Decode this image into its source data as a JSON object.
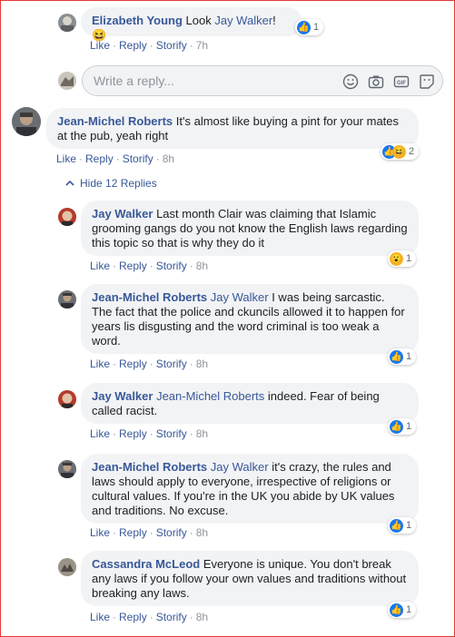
{
  "comments": [
    {
      "author": "Elizabeth Young",
      "mention": "",
      "text": " Look ",
      "mention_after": "Jay Walker",
      "text_after": "! 😆",
      "actions": [
        "Like",
        "Reply",
        "Storify"
      ],
      "time": "7h",
      "reaction_count": "1"
    },
    {
      "author": "Jean-Michel Roberts",
      "mention": "",
      "text": " It's almost like buying a pint for your mates at the pub, yeah right",
      "actions": [
        "Like",
        "Reply",
        "Storify"
      ],
      "time": "8h",
      "reaction_count": "2"
    },
    {
      "author": "Jay Walker",
      "mention": "",
      "text": " Last month Clair was claiming that Islamic grooming gangs do you not know the English laws regarding this topic so that is why they do it",
      "actions": [
        "Like",
        "Reply",
        "Storify"
      ],
      "time": "8h",
      "reaction_count": "1"
    },
    {
      "author": "Jean-Michel Roberts",
      "mention": "Jay Walker",
      "text": " I was being sarcastic. The fact that the police and ckuncils allowed it to happen for years lis disgusting and the word criminal is too weak a word.",
      "actions": [
        "Like",
        "Reply",
        "Storify"
      ],
      "time": "8h",
      "reaction_count": "1"
    },
    {
      "author": "Jay Walker",
      "mention": "Jean-Michel Roberts",
      "text": " indeed. Fear of being called racist.",
      "actions": [
        "Like",
        "Reply",
        "Storify"
      ],
      "time": "8h",
      "reaction_count": "1"
    },
    {
      "author": "Jean-Michel Roberts",
      "mention": "Jay Walker",
      "text": " it's crazy, the rules and laws should apply to everyone, irrespective of religions or cultural values. If you're in the UK you abide by UK values and traditions. No excuse.",
      "actions": [
        "Like",
        "Reply",
        "Storify"
      ],
      "time": "8h",
      "reaction_count": "1"
    },
    {
      "author": "Cassandra McLeod",
      "mention": "",
      "text": " Everyone is unique. You don't break any laws if you follow your own values and traditions without breaking any laws.",
      "actions": [
        "Like",
        "Reply",
        "Storify"
      ],
      "time": "8h",
      "reaction_count": "1"
    }
  ],
  "reply_box": {
    "placeholder": "Write a reply..."
  },
  "hide_replies_label": "Hide 12 Replies",
  "icons": {
    "emoji": "smiley-icon",
    "camera": "camera-icon",
    "gif": "gif-icon",
    "sticker": "sticker-icon",
    "like": "like-icon",
    "haha": "haha-icon",
    "wow": "wow-icon"
  },
  "colors": {
    "link": "#385898",
    "bubble": "#f2f3f5",
    "like": "#1877f2",
    "meta": "#90949c"
  }
}
